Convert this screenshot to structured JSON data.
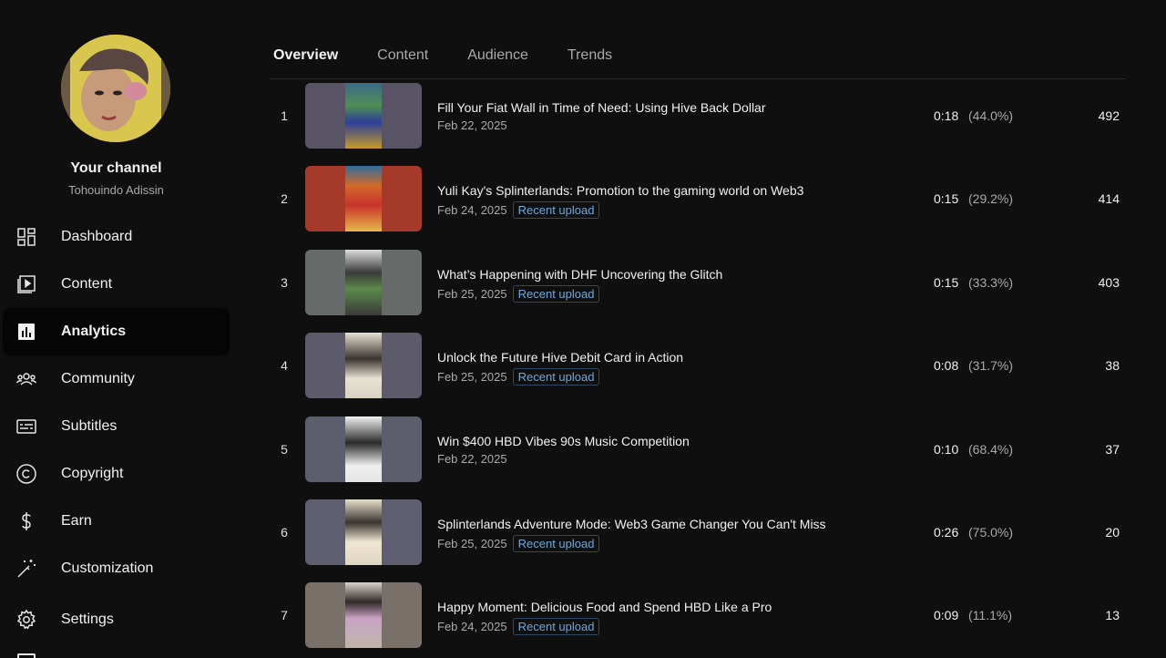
{
  "sidebar": {
    "channel_title": "Your channel",
    "channel_name": "Tohouindo Adissin",
    "items": [
      {
        "label": "Dashboard",
        "icon": "dashboard-icon"
      },
      {
        "label": "Content",
        "icon": "content-icon"
      },
      {
        "label": "Analytics",
        "icon": "analytics-icon",
        "active": true
      },
      {
        "label": "Community",
        "icon": "community-icon"
      },
      {
        "label": "Subtitles",
        "icon": "subtitles-icon"
      },
      {
        "label": "Copyright",
        "icon": "copyright-icon"
      },
      {
        "label": "Earn",
        "icon": "dollar-icon"
      },
      {
        "label": "Customization",
        "icon": "magic-wand-icon"
      },
      {
        "label": "Settings",
        "icon": "gear-icon"
      }
    ]
  },
  "tabs": [
    {
      "label": "Overview",
      "active": true
    },
    {
      "label": "Content"
    },
    {
      "label": "Audience"
    },
    {
      "label": "Trends"
    }
  ],
  "videos": [
    {
      "rank": "1",
      "title": "Fill Your Fiat Wall in Time of Need: Using Hive Back Dollar",
      "date": "Feb 22, 2025",
      "badge": "",
      "duration": "0:18",
      "percent": "(44.0%)",
      "views": "492"
    },
    {
      "rank": "2",
      "title": "Yuli Kay's Splinterlands: Promotion to the gaming world on Web3",
      "date": "Feb 24, 2025",
      "badge": "Recent upload",
      "duration": "0:15",
      "percent": "(29.2%)",
      "views": "414"
    },
    {
      "rank": "3",
      "title": "What’s Happening with DHF Uncovering the Glitch",
      "date": "Feb 25, 2025",
      "badge": "Recent upload",
      "duration": "0:15",
      "percent": "(33.3%)",
      "views": "403"
    },
    {
      "rank": "4",
      "title": "Unlock the Future Hive Debit Card in Action",
      "date": "Feb 25, 2025",
      "badge": "Recent upload",
      "duration": "0:08",
      "percent": "(31.7%)",
      "views": "38"
    },
    {
      "rank": "5",
      "title": "Win $400 HBD Vibes 90s Music Competition",
      "date": "Feb 22, 2025",
      "badge": "",
      "duration": "0:10",
      "percent": "(68.4%)",
      "views": "37"
    },
    {
      "rank": "6",
      "title": "Splinterlands Adventure Mode: Web3 Game Changer You Can't Miss",
      "date": "Feb 25, 2025",
      "badge": "Recent upload",
      "duration": "0:26",
      "percent": "(75.0%)",
      "views": "20"
    },
    {
      "rank": "7",
      "title": "Happy Moment: Delicious Food and Spend HBD Like a Pro",
      "date": "Feb 24, 2025",
      "badge": "Recent upload",
      "duration": "0:09",
      "percent": "(11.1%)",
      "views": "13"
    }
  ],
  "colors": {
    "background": "#0f0f0f",
    "active_nav": "#050505",
    "badge_text": "#6fa8dc"
  }
}
